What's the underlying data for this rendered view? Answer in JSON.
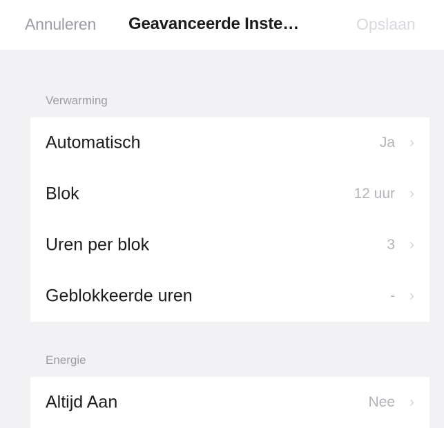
{
  "navbar": {
    "cancel_label": "Annuleren",
    "title": "Geavanceerde Inste…",
    "save_label": "Opslaan"
  },
  "sections": [
    {
      "header": "Verwarming",
      "rows": [
        {
          "label": "Automatisch",
          "value": "Ja"
        },
        {
          "label": "Blok",
          "value": "12 uur"
        },
        {
          "label": "Uren per blok",
          "value": "3"
        },
        {
          "label": "Geblokkeerde uren",
          "value": "-"
        }
      ]
    },
    {
      "header": "Energie",
      "rows": [
        {
          "label": "Altijd Aan",
          "value": "Nee"
        }
      ]
    }
  ],
  "icons": {
    "chevron": "chevron-right-icon"
  },
  "colors": {
    "background": "#f2f2f4",
    "label": "#1c1c1e",
    "secondary": "#9c9ca4",
    "value": "#b3b3ba"
  }
}
